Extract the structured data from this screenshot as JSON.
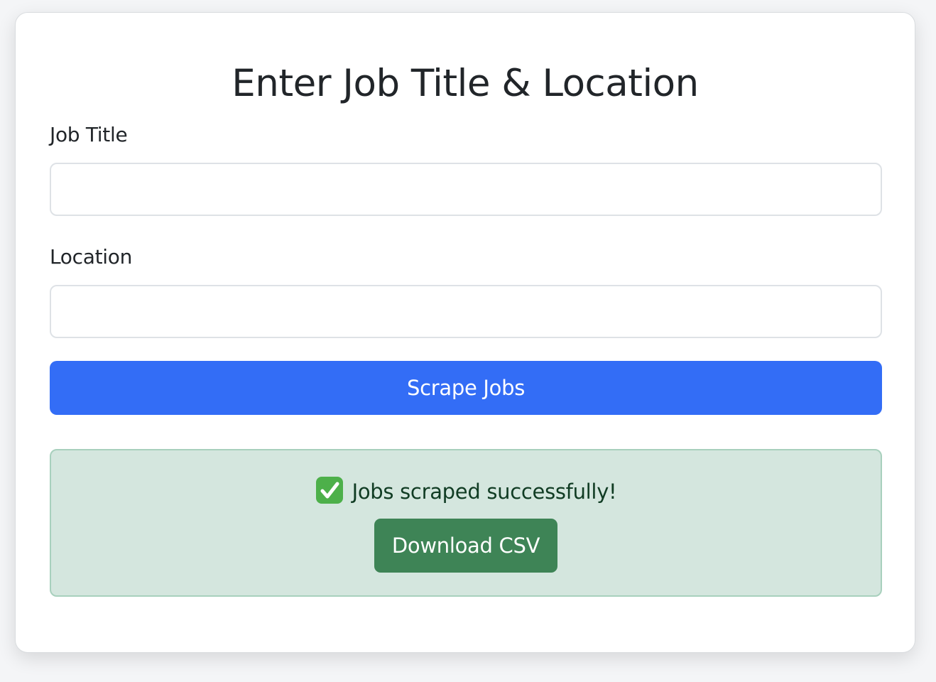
{
  "form": {
    "title": "Enter Job Title & Location",
    "job_title_label": "Job Title",
    "job_title_value": "",
    "location_label": "Location",
    "location_value": "",
    "submit_label": "Scrape Jobs"
  },
  "alert": {
    "icon": "check-mark-button-icon",
    "message": "Jobs scraped successfully!",
    "download_label": "Download CSV"
  },
  "colors": {
    "primary": "#336df6",
    "success_bg": "#d4e6de",
    "success_border": "#a8d0bd",
    "success_button": "#3e8456",
    "check_icon": "#4db04a"
  }
}
